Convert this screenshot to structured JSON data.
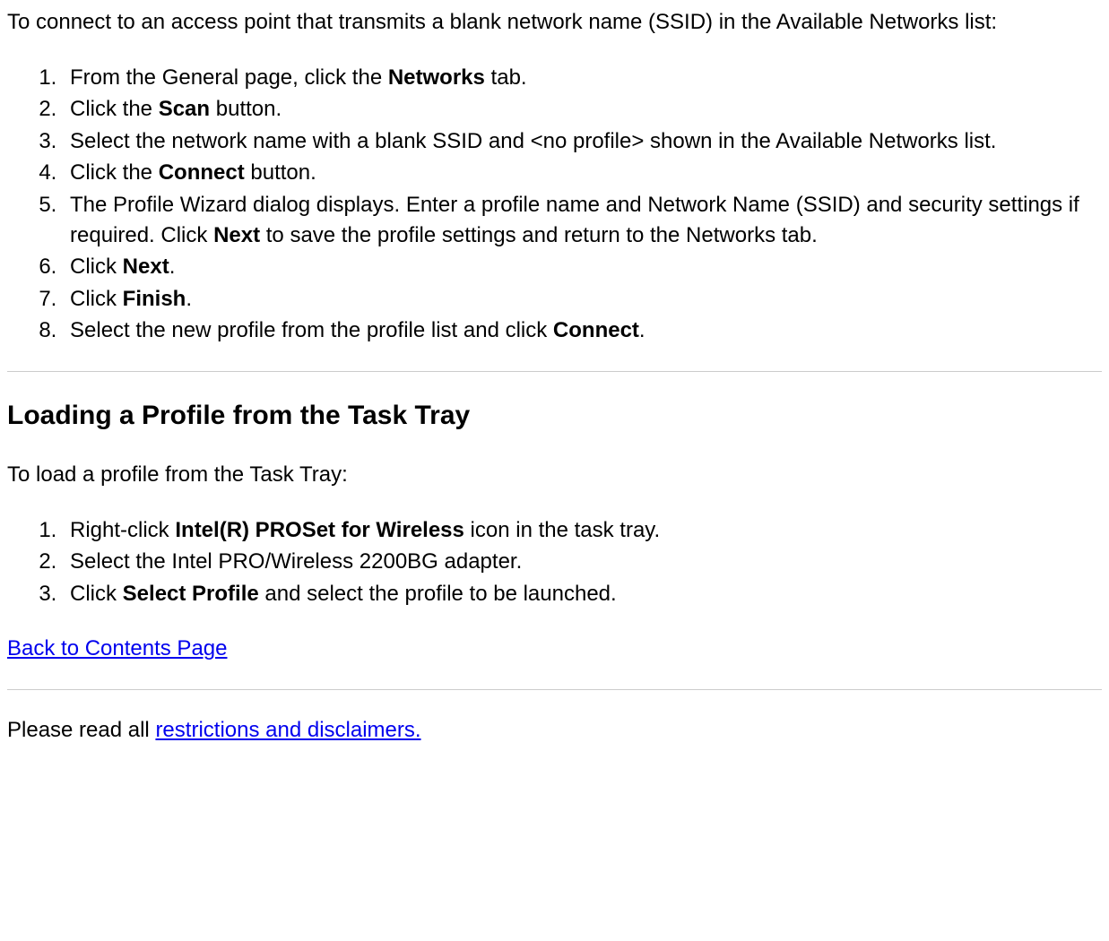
{
  "intro1": "To connect to an access point that transmits a blank network name (SSID) in the Available Networks list:",
  "list1": {
    "item1_a": "From the General page, click the ",
    "item1_b": "Networks",
    "item1_c": " tab.",
    "item2_a": "Click the ",
    "item2_b": "Scan",
    "item2_c": " button.",
    "item3": "Select the network name with a blank SSID and <no profile> shown in the Available Networks list.",
    "item4_a": "Click the ",
    "item4_b": "Connect",
    "item4_c": " button.",
    "item5_a": "The Profile Wizard dialog displays. Enter a profile name and Network Name (SSID) and security settings if required. Click ",
    "item5_b": "Next",
    "item5_c": " to save the profile settings and return to the Networks tab.",
    "item6_a": "Click ",
    "item6_b": "Next",
    "item6_c": ".",
    "item7_a": "Click ",
    "item7_b": "Finish",
    "item7_c": ".",
    "item8_a": "Select the new profile from the profile list and click ",
    "item8_b": "Connect",
    "item8_c": "."
  },
  "heading2": "Loading a Profile from the Task Tray",
  "intro2": "To load a profile from the Task Tray:",
  "list2": {
    "item1_a": "Right-click ",
    "item1_b": "Intel(R) PROSet for Wireless",
    "item1_c": " icon in the task tray.",
    "item2": "Select the Intel PRO/Wireless 2200BG adapter.",
    "item3_a": "Click ",
    "item3_b": "Select Profile",
    "item3_c": " and select the profile to be launched."
  },
  "back_link": "Back to Contents Page",
  "footer_a": "Please read all ",
  "footer_link": "restrictions and disclaimers."
}
